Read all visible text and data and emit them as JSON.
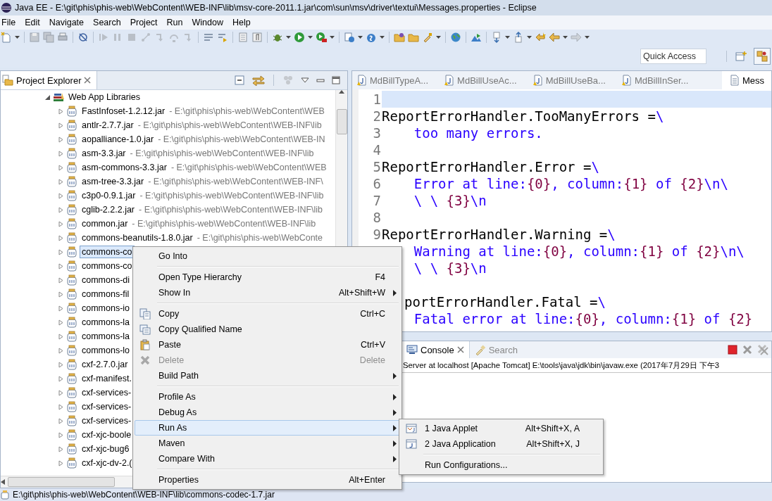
{
  "window": {
    "title": "Java EE - E:\\git\\phis\\phis-web\\WebContent\\WEB-INF\\lib\\msv-core-2011.1.jar\\com\\sun\\msv\\driver\\textui\\Messages.properties - Eclipse"
  },
  "menu_bar": [
    "File",
    "Edit",
    "Navigate",
    "Search",
    "Project",
    "Run",
    "Window",
    "Help"
  ],
  "quick_access": {
    "placeholder": "Quick Access"
  },
  "project_explorer": {
    "title": "Project Explorer",
    "tree": [
      {
        "label": "Web App Libraries",
        "expanded": true,
        "selected": false,
        "children": [
          {
            "label": "FastInfoset-1.2.12.jar",
            "location": "- E:\\git\\phis\\phis-web\\WebContent\\WEB",
            "expanded": false,
            "selected": false
          },
          {
            "label": "antlr-2.7.7.jar",
            "location": "- E:\\git\\phis\\phis-web\\WebContent\\WEB-INF\\lib",
            "expanded": false,
            "selected": false
          },
          {
            "label": "aopalliance-1.0.jar",
            "location": "- E:\\git\\phis\\phis-web\\WebContent\\WEB-IN",
            "expanded": false,
            "selected": false
          },
          {
            "label": "asm-3.3.jar",
            "location": "- E:\\git\\phis\\phis-web\\WebContent\\WEB-INF\\lib",
            "expanded": false,
            "selected": false
          },
          {
            "label": "asm-commons-3.3.jar",
            "location": "- E:\\git\\phis\\phis-web\\WebContent\\WEB",
            "expanded": false,
            "selected": false
          },
          {
            "label": "asm-tree-3.3.jar",
            "location": "- E:\\git\\phis\\phis-web\\WebContent\\WEB-INF\\",
            "expanded": false,
            "selected": false
          },
          {
            "label": "c3p0-0.9.1.jar",
            "location": "- E:\\git\\phis\\phis-web\\WebContent\\WEB-INF\\lib",
            "expanded": false,
            "selected": false
          },
          {
            "label": "cglib-2.2.2.jar",
            "location": "- E:\\git\\phis\\phis-web\\WebContent\\WEB-INF\\lib",
            "expanded": false,
            "selected": false
          },
          {
            "label": "common.jar",
            "location": "- E:\\git\\phis\\phis-web\\WebContent\\WEB-INF\\lib",
            "expanded": false,
            "selected": false
          },
          {
            "label": "commons-beanutils-1.8.0.jar",
            "location": "- E:\\git\\phis\\phis-web\\WebConte",
            "expanded": false,
            "selected": false
          },
          {
            "label": "commons-co",
            "expanded": false,
            "selected": true
          },
          {
            "label": "commons-co",
            "expanded": false,
            "selected": false
          },
          {
            "label": "commons-di",
            "expanded": false,
            "selected": false
          },
          {
            "label": "commons-fil",
            "expanded": false,
            "selected": false
          },
          {
            "label": "commons-io",
            "expanded": false,
            "selected": false
          },
          {
            "label": "commons-la",
            "expanded": false,
            "selected": false
          },
          {
            "label": "commons-la",
            "expanded": false,
            "selected": false
          },
          {
            "label": "commons-lo",
            "expanded": false,
            "selected": false
          },
          {
            "label": "cxf-2.7.0.jar",
            "expanded": false,
            "selected": false
          },
          {
            "label": "cxf-manifest.",
            "expanded": false,
            "selected": false
          },
          {
            "label": "cxf-services-",
            "expanded": false,
            "selected": false
          },
          {
            "label": "cxf-services-",
            "expanded": false,
            "selected": false
          },
          {
            "label": "cxf-services-",
            "expanded": false,
            "selected": false
          },
          {
            "label": "cxf-xjc-boole",
            "expanded": false,
            "selected": false
          },
          {
            "label": "cxf-xjc-bug6",
            "expanded": false,
            "selected": false
          },
          {
            "label": "cxf-xjc-dv-2.(",
            "expanded": false,
            "selected": false
          }
        ]
      }
    ]
  },
  "editor": {
    "tabs": [
      {
        "label": "MdBillTypeA...",
        "selected": false
      },
      {
        "label": "MdBillUseAc...",
        "selected": false
      },
      {
        "label": "MdBillUseBa...",
        "selected": false
      },
      {
        "label": "MdBillInSer...",
        "selected": false
      },
      {
        "label": "Mess",
        "selected": true
      }
    ],
    "lines": [
      {
        "number": "1",
        "kind": "key",
        "highlighted": true
      },
      {
        "number": "2",
        "kind": "key",
        "highlighted": false,
        "segments": [
          {
            "kind": "key",
            "text": "ReportErrorHandler.TooManyErrors ="
          },
          {
            "kind": "value",
            "text": "\\"
          }
        ]
      },
      {
        "number": "3",
        "kind": "value",
        "highlighted": false,
        "segments": [
          {
            "kind": "value",
            "text": "too many errors."
          }
        ]
      },
      {
        "number": "4",
        "kind": "key",
        "highlighted": false
      },
      {
        "number": "5",
        "kind": "key",
        "highlighted": false,
        "segments": [
          {
            "kind": "key",
            "text": "ReportErrorHandler.Error ="
          },
          {
            "kind": "value",
            "text": "\\"
          }
        ]
      },
      {
        "number": "6",
        "kind": "value",
        "highlighted": false,
        "segments": [
          {
            "kind": "value",
            "text": "Error at line:"
          },
          {
            "kind": "arg",
            "text": "{0}"
          },
          {
            "kind": "value",
            "text": ", column:"
          },
          {
            "kind": "arg",
            "text": "{1}"
          },
          {
            "kind": "value",
            "text": " of "
          },
          {
            "kind": "arg",
            "text": "{2}"
          },
          {
            "kind": "value",
            "text": "\\n\\"
          }
        ]
      },
      {
        "number": "7",
        "kind": "value",
        "highlighted": false,
        "segments": [
          {
            "kind": "value",
            "text": "\\ \\ "
          },
          {
            "kind": "arg",
            "text": "{3}"
          },
          {
            "kind": "value",
            "text": "\\n"
          }
        ]
      },
      {
        "number": "8",
        "kind": "key",
        "highlighted": false
      },
      {
        "number": "9",
        "kind": "key",
        "highlighted": false,
        "segments": [
          {
            "kind": "key",
            "text": "ReportErrorHandler.Warning ="
          },
          {
            "kind": "value",
            "text": "\\"
          }
        ]
      },
      {
        "kind": "value",
        "highlighted": false,
        "segments": [
          {
            "kind": "value",
            "text": "Warning at line:"
          },
          {
            "kind": "arg",
            "text": "{0}"
          },
          {
            "kind": "value",
            "text": ", column:"
          },
          {
            "kind": "arg",
            "text": "{1}"
          },
          {
            "kind": "value",
            "text": " of "
          },
          {
            "kind": "arg",
            "text": "{2}"
          },
          {
            "kind": "value",
            "text": "\\n\\"
          }
        ]
      },
      {
        "kind": "value",
        "highlighted": false,
        "segments": [
          {
            "kind": "value",
            "text": "\\ \\ "
          },
          {
            "kind": "arg",
            "text": "{3}"
          },
          {
            "kind": "value",
            "text": "\\n"
          }
        ]
      },
      {
        "kind": "key",
        "highlighted": false
      },
      {
        "kind": "covered",
        "highlighted": false,
        "segments": [
          {
            "kind": "key",
            "text": "portErrorHandler.Fatal ="
          },
          {
            "kind": "value",
            "text": "\\"
          }
        ]
      },
      {
        "kind": "value",
        "highlighted": false,
        "segments": [
          {
            "kind": "value",
            "text": "Fatal error at line:"
          },
          {
            "kind": "arg",
            "text": "{0}"
          },
          {
            "kind": "value",
            "text": ", column:"
          },
          {
            "kind": "arg",
            "text": "{1}"
          },
          {
            "kind": "value",
            "text": " of "
          },
          {
            "kind": "arg",
            "text": "{2}"
          }
        ]
      }
    ]
  },
  "console": {
    "tabs": [
      {
        "label": "Console",
        "selected": true
      },
      {
        "label": "Search",
        "selected": false
      }
    ],
    "description": "Server at localhost [Apache Tomcat] E:\\tools\\java\\jdk\\bin\\javaw.exe (2017年7月29日 下午3"
  },
  "context_menu": {
    "items": [
      {
        "kind": "item",
        "label": "Go Into",
        "submenu": false,
        "disabled": false,
        "highlighted": false
      },
      {
        "kind": "separator"
      },
      {
        "kind": "item",
        "label": "Open Type Hierarchy",
        "shortcut": "F4",
        "submenu": false,
        "disabled": false,
        "highlighted": false
      },
      {
        "kind": "item",
        "label": "Show In",
        "shortcut": "Alt+Shift+W",
        "submenu": true,
        "disabled": false,
        "highlighted": false
      },
      {
        "kind": "separator"
      },
      {
        "kind": "item",
        "label": "Copy",
        "shortcut": "Ctrl+C",
        "submenu": false,
        "disabled": false,
        "highlighted": false
      },
      {
        "kind": "item",
        "label": "Copy Qualified Name",
        "submenu": false,
        "disabled": false,
        "highlighted": false
      },
      {
        "kind": "item",
        "label": "Paste",
        "shortcut": "Ctrl+V",
        "submenu": false,
        "disabled": false,
        "highlighted": false
      },
      {
        "kind": "item",
        "label": "Delete",
        "shortcut": "Delete",
        "submenu": false,
        "disabled": true,
        "highlighted": false
      },
      {
        "kind": "item",
        "label": "Build Path",
        "submenu": true,
        "disabled": false,
        "highlighted": false
      },
      {
        "kind": "separator"
      },
      {
        "kind": "item",
        "label": "Profile As",
        "submenu": true,
        "disabled": false,
        "highlighted": false
      },
      {
        "kind": "item",
        "label": "Debug As",
        "submenu": true,
        "disabled": false,
        "highlighted": false
      },
      {
        "kind": "item",
        "label": "Run As",
        "submenu": true,
        "disabled": false,
        "highlighted": true
      },
      {
        "kind": "item",
        "label": "Maven",
        "submenu": true,
        "disabled": false,
        "highlighted": false
      },
      {
        "kind": "item",
        "label": "Compare With",
        "submenu": true,
        "disabled": false,
        "highlighted": false
      },
      {
        "kind": "separator"
      },
      {
        "kind": "item",
        "label": "Properties",
        "shortcut": "Alt+Enter",
        "submenu": false,
        "disabled": false,
        "highlighted": false
      }
    ],
    "submenu": {
      "items": [
        {
          "kind": "item",
          "label": "1 Java Applet",
          "shortcut": "Alt+Shift+X, A",
          "highlighted": false
        },
        {
          "kind": "item",
          "label": "2 Java Application",
          "shortcut": "Alt+Shift+X, J",
          "highlighted": false
        },
        {
          "kind": "separator"
        },
        {
          "kind": "item",
          "label": "Run Configurations...",
          "highlighted": false
        }
      ]
    }
  },
  "status_bar": {
    "text": "E:\\git\\phis\\phis-web\\WebContent\\WEB-INF\\lib\\commons-codec-1.7.jar"
  }
}
